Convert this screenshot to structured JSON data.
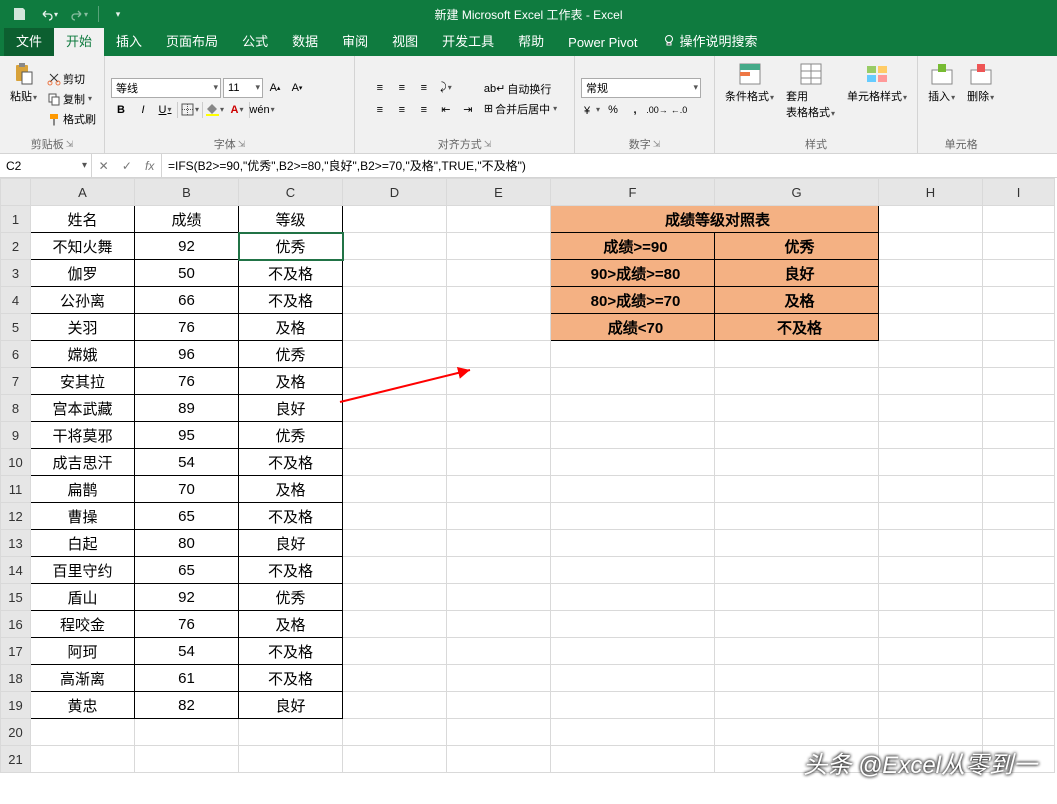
{
  "title": "新建 Microsoft Excel 工作表 - Excel",
  "tabs": {
    "file": "文件",
    "home": "开始",
    "insert": "插入",
    "layout": "页面布局",
    "formulas": "公式",
    "data": "数据",
    "review": "审阅",
    "view": "视图",
    "dev": "开发工具",
    "help": "帮助",
    "pivot": "Power Pivot",
    "tell": "操作说明搜索"
  },
  "ribbon": {
    "clipboard": {
      "paste": "粘贴",
      "cut": "剪切",
      "copy": "复制",
      "painter": "格式刷",
      "label": "剪贴板"
    },
    "font": {
      "name": "等线",
      "size": "11",
      "bold": "B",
      "italic": "I",
      "underline": "U",
      "wen": "wén",
      "label": "字体"
    },
    "align": {
      "wrap": "自动换行",
      "merge": "合并后居中",
      "label": "对齐方式"
    },
    "number": {
      "fmt": "常规",
      "label": "数字"
    },
    "styles": {
      "cond": "条件格式",
      "table": "套用\n表格格式",
      "cell": "单元格样式",
      "label": "样式"
    },
    "cells": {
      "ins": "插入",
      "del": "删除",
      "label": "单元格"
    }
  },
  "namebox": "C2",
  "formula": "=IFS(B2>=90,\"优秀\",B2>=80,\"良好\",B2>=70,\"及格\",TRUE,\"不及格\")",
  "columns": [
    "A",
    "B",
    "C",
    "D",
    "E",
    "F",
    "G",
    "H",
    "I"
  ],
  "rows": 21,
  "data": {
    "headers": [
      "姓名",
      "成绩",
      "等级"
    ],
    "records": [
      [
        "不知火舞",
        "92",
        "优秀"
      ],
      [
        "伽罗",
        "50",
        "不及格"
      ],
      [
        "公孙离",
        "66",
        "不及格"
      ],
      [
        "关羽",
        "76",
        "及格"
      ],
      [
        "嫦娥",
        "96",
        "优秀"
      ],
      [
        "安其拉",
        "76",
        "及格"
      ],
      [
        "宫本武藏",
        "89",
        "良好"
      ],
      [
        "干将莫邪",
        "95",
        "优秀"
      ],
      [
        "成吉思汗",
        "54",
        "不及格"
      ],
      [
        "扁鹊",
        "70",
        "及格"
      ],
      [
        "曹操",
        "65",
        "不及格"
      ],
      [
        "白起",
        "80",
        "良好"
      ],
      [
        "百里守约",
        "65",
        "不及格"
      ],
      [
        "盾山",
        "92",
        "优秀"
      ],
      [
        "程咬金",
        "76",
        "及格"
      ],
      [
        "阿珂",
        "54",
        "不及格"
      ],
      [
        "高渐离",
        "61",
        "不及格"
      ],
      [
        "黄忠",
        "82",
        "良好"
      ]
    ]
  },
  "lookup": {
    "title": "成绩等级对照表",
    "rows": [
      [
        "成绩>=90",
        "优秀"
      ],
      [
        "90>成绩>=80",
        "良好"
      ],
      [
        "80>成绩>=70",
        "及格"
      ],
      [
        "成绩<70",
        "不及格"
      ]
    ]
  },
  "watermark": "头条 @Excel从零到一"
}
